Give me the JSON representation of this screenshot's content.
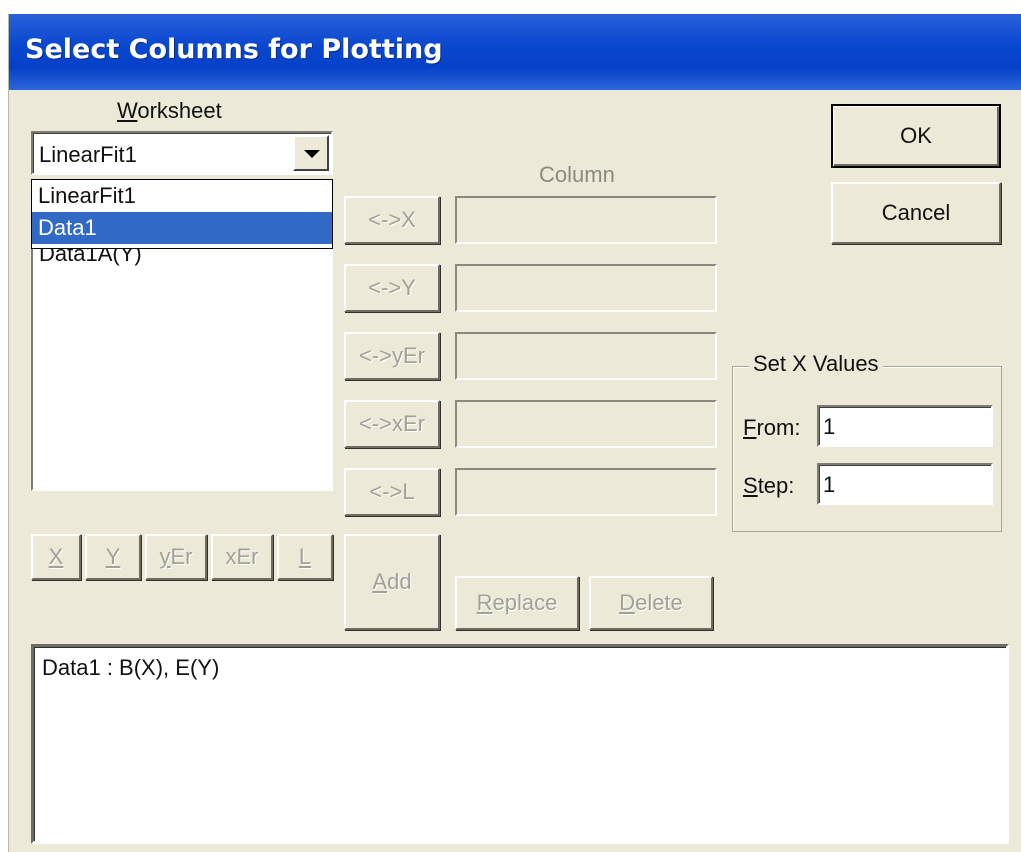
{
  "window": {
    "title": "Select Columns for Plotting"
  },
  "worksheet": {
    "label_u": "W",
    "label_rest": "orksheet",
    "selected": "LinearFit1",
    "options": [
      "LinearFit1",
      "Data1"
    ],
    "highlighted_option": "Data1",
    "list_items": [
      "Data1A(Y)"
    ]
  },
  "column": {
    "header": "Column",
    "assign_buttons": [
      "<->X",
      "<->Y",
      "<->yEr",
      "<->xEr",
      "<->L"
    ],
    "values": [
      "",
      "",
      "",
      "",
      ""
    ]
  },
  "type_buttons": [
    {
      "u": "X",
      "rest": ""
    },
    {
      "u": "Y",
      "rest": ""
    },
    {
      "u": "y",
      "rest": "Er"
    },
    {
      "u": "",
      "rest": "xEr"
    },
    {
      "u": "L",
      "rest": ""
    }
  ],
  "actions": {
    "add_u": "A",
    "add_rest": "dd",
    "replace_u": "R",
    "replace_rest": "eplace",
    "delete_u": "D",
    "delete_rest": "elete"
  },
  "dialog_buttons": {
    "ok": "OK",
    "cancel": "Cancel"
  },
  "set_x_values": {
    "legend": "Set X Values",
    "from_u": "F",
    "from_rest": "rom:",
    "from_value": "1",
    "step_u": "S",
    "step_rest": "tep:",
    "step_value": "1"
  },
  "summary": {
    "lines": [
      "Data1 : B(X), E(Y)"
    ]
  },
  "colors": {
    "titlebar": "#0a48d0",
    "dialog_bg": "#ece9d8",
    "selection": "#316ac5"
  }
}
